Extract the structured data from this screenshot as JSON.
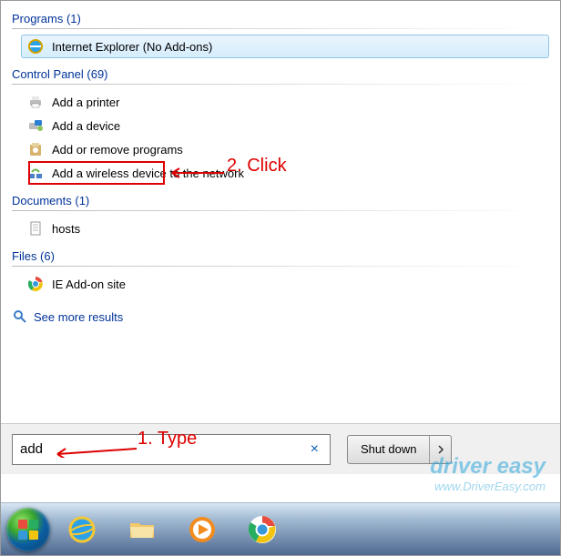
{
  "results": {
    "programs": {
      "header": "Programs (1)",
      "items": [
        {
          "icon": "ie",
          "label": "Internet Explorer (No Add-ons)",
          "selected": true
        }
      ]
    },
    "controlPanel": {
      "header": "Control Panel (69)",
      "items": [
        {
          "icon": "printer",
          "label": "Add a printer"
        },
        {
          "icon": "device",
          "label": "Add a device",
          "highlighted": true
        },
        {
          "icon": "programs",
          "label": "Add or remove programs"
        },
        {
          "icon": "wireless",
          "label": "Add a wireless device to the network"
        }
      ]
    },
    "documents": {
      "header": "Documents (1)",
      "items": [
        {
          "icon": "textfile",
          "label": "hosts"
        }
      ]
    },
    "files": {
      "header": "Files (6)",
      "items": [
        {
          "icon": "chrome",
          "label": "IE Add-on site"
        }
      ]
    },
    "seeMore": "See more results"
  },
  "search": {
    "value": "add",
    "clear": "×"
  },
  "shutdown": {
    "label": "Shut down"
  },
  "annotations": {
    "step1": "1. Type",
    "step2": "2. Click"
  },
  "watermark": {
    "main": "driver easy",
    "sub": "www.DriverEasy.com"
  }
}
